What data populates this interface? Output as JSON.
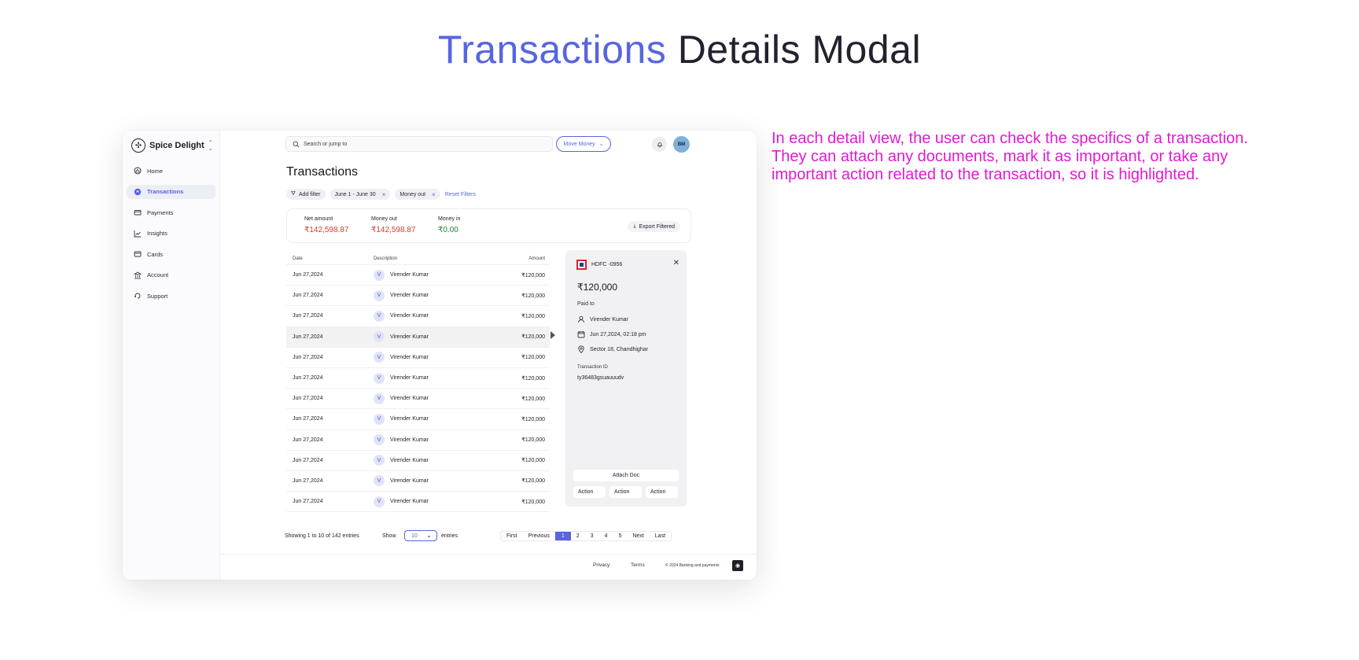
{
  "headline": {
    "accent": "Transactions",
    "rest": "Details Modal"
  },
  "annotation": "In each detail view, the user can check the specifics of a transaction. They can attach any documents, mark it as important, or take any important action related to the transaction, so it is highlighted.",
  "sidebar": {
    "brand": "Spice Delight",
    "items": [
      {
        "label": "Home",
        "icon": "home-icon"
      },
      {
        "label": "Transactions",
        "icon": "transactions-icon",
        "active": true
      },
      {
        "label": "Payments",
        "icon": "payments-icon"
      },
      {
        "label": "Insights",
        "icon": "insights-icon"
      },
      {
        "label": "Cards",
        "icon": "cards-icon"
      },
      {
        "label": "Account",
        "icon": "bank-icon"
      },
      {
        "label": "Support",
        "icon": "support-icon"
      }
    ]
  },
  "topbar": {
    "search_placeholder": "Search or jump to",
    "move_money": "Move Money",
    "avatar_initials": "BM"
  },
  "page": {
    "title": "Transactions",
    "filters": {
      "add": "Add filter",
      "chip1": "June 1 - June 30",
      "chip2": "Money out",
      "reset": "Reset Filters"
    },
    "summary": {
      "net_label": "Net amount",
      "net_value": "₹142,598.87",
      "out_label": "Money out",
      "out_value": "₹142,598.87",
      "in_label": "Money in",
      "in_value": "₹0.00",
      "export": "Export Filtered"
    },
    "table": {
      "headers": {
        "date": "Date",
        "description": "Description",
        "amount": "Amount"
      },
      "rows": [
        {
          "date": "Jun 27,2024",
          "badge": "V",
          "name": "Virender Kumar",
          "amount": "₹120,000"
        },
        {
          "date": "Jun 27,2024",
          "badge": "V",
          "name": "Virender Kumar",
          "amount": "₹120,000"
        },
        {
          "date": "Jun 27,2024",
          "badge": "V",
          "name": "Virender Kumar",
          "amount": "₹120,000"
        },
        {
          "date": "Jun 27,2024",
          "badge": "V",
          "name": "Virender Kumar",
          "amount": "₹120,000"
        },
        {
          "date": "Jun 27,2024",
          "badge": "V",
          "name": "Virender Kumar",
          "amount": "₹120,000"
        },
        {
          "date": "Jun 27,2024",
          "badge": "V",
          "name": "Virender Kumar",
          "amount": "₹120,000"
        },
        {
          "date": "Jun 27,2024",
          "badge": "V",
          "name": "Virender Kumar",
          "amount": "₹120,000"
        },
        {
          "date": "Jun 27,2024",
          "badge": "V",
          "name": "Virender Kumar",
          "amount": "₹120,000"
        },
        {
          "date": "Jun 27,2024",
          "badge": "V",
          "name": "Virender Kumar",
          "amount": "₹120,000"
        },
        {
          "date": "Jun 27,2024",
          "badge": "V",
          "name": "Virender Kumar",
          "amount": "₹120,000"
        },
        {
          "date": "Jun 27,2024",
          "badge": "V",
          "name": "Virender Kumar",
          "amount": "₹120,000"
        },
        {
          "date": "Jun 27,2024",
          "badge": "V",
          "name": "Virender Kumar",
          "amount": "₹120,000"
        }
      ]
    },
    "detail": {
      "account": "HDFC -0956",
      "amount": "₹120,000",
      "paid_to_label": "Paid to",
      "payee": "Virender Kumar",
      "datetime": "Jun 27,2024, 02:18 pm",
      "location": "Sector 18, Chandhighar",
      "txid_label": "Transaction ID",
      "txid": "ty36483gsuauuudv",
      "attach": "Attach Doc",
      "actions": [
        "Action",
        "Action",
        "Action"
      ]
    },
    "pagination": {
      "info": "Showing 1 to 10 of 142 entries",
      "show": "Show",
      "page_size": "10",
      "entries": "entries",
      "first": "First",
      "previous": "Previous",
      "pages": [
        "1",
        "2",
        "3",
        "4",
        "5"
      ],
      "next": "Next",
      "last": "Last"
    },
    "footer": {
      "privacy": "Privacy",
      "terms": "Terms",
      "copyright": "© 2024 Banking and payments"
    }
  },
  "colors": {
    "accent": "#5865e0",
    "annotation": "#e319d6",
    "negative": "#d73a2f",
    "positive": "#1a8a3a"
  }
}
